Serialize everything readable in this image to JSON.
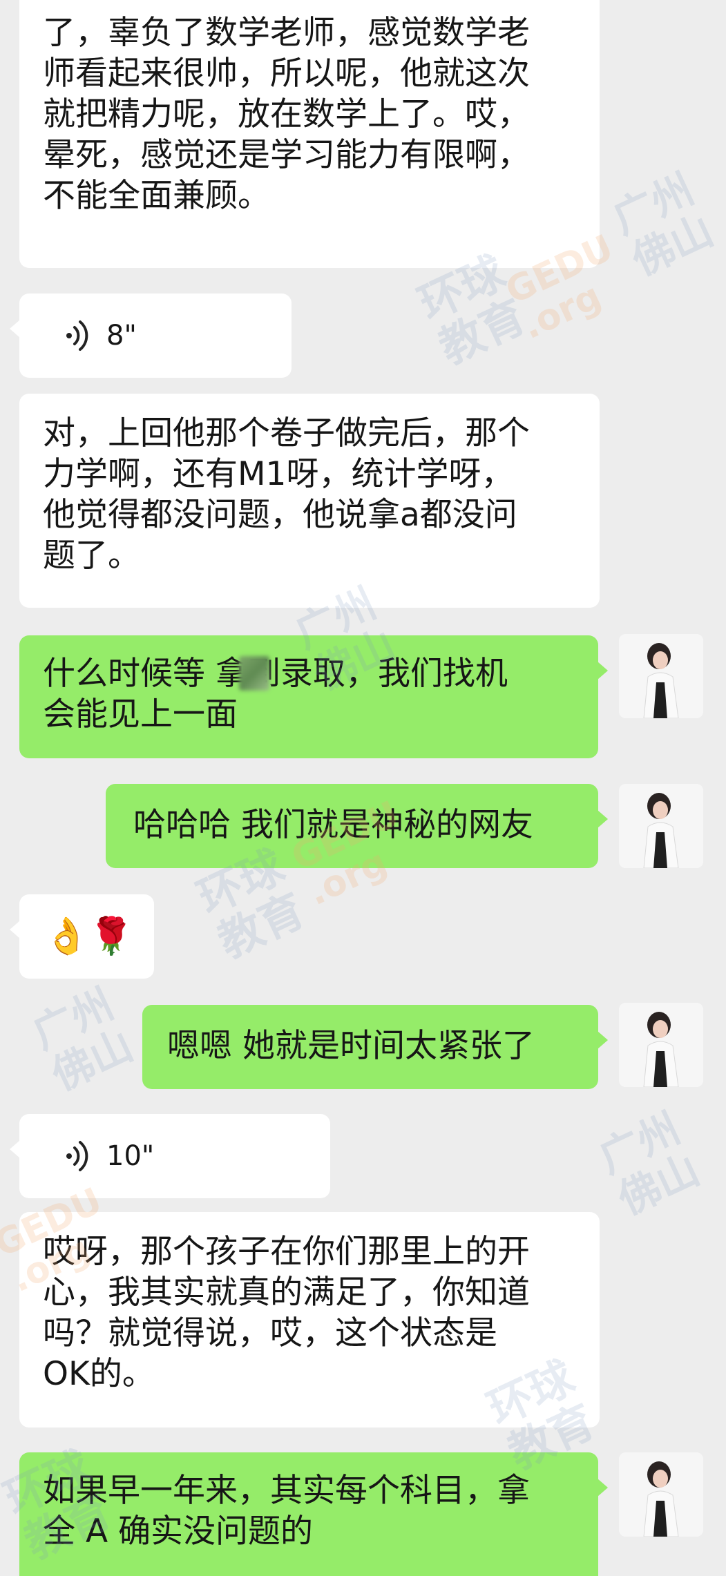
{
  "messages": [
    {
      "type": "text",
      "side": "left",
      "text": "了，辜负了数学老师，感觉数学老\n师看起来很帅，所以呢，他就这次\n就把精力呢，放在数学上了。哎，\n晕死，感觉还是学习能力有限啊，\n不能全面兼顾。"
    },
    {
      "type": "voice",
      "side": "left",
      "duration": "8\""
    },
    {
      "type": "text",
      "side": "left",
      "text": "对，上回他那个卷子做完后，那个\n力学啊，还有M1呀，统计学呀，\n他觉得都没问题，他说拿a都没问\n题了。"
    },
    {
      "type": "text",
      "side": "right",
      "text": "什么时候等   拿到录取，我们找机\n会能见上一面"
    },
    {
      "type": "text",
      "side": "right",
      "text": "哈哈哈 我们就是神秘的网友"
    },
    {
      "type": "emoji",
      "side": "left",
      "text": "👌🌹"
    },
    {
      "type": "text",
      "side": "right",
      "text": "嗯嗯 她就是时间太紧张了"
    },
    {
      "type": "voice",
      "side": "left",
      "duration": "10\""
    },
    {
      "type": "text",
      "side": "left",
      "text": "哎呀，那个孩子在你们那里上的开\n心，我其实就真的满足了，你知道\n吗？就觉得说，哎，这个状态是\nOK的。"
    },
    {
      "type": "text",
      "side": "right",
      "text": "如果早一年来，其实每个科目，拿\n全 A 确实没问题的"
    }
  ],
  "watermark": {
    "line1": "广州",
    "line2": "佛山",
    "brand": "环球",
    "brand2": "教育",
    "gedu": "GEDU",
    "org": ".org"
  },
  "colors": {
    "background": "#ededed",
    "incoming_bubble": "#ffffff",
    "outgoing_bubble": "#95ec69",
    "text": "#161616"
  }
}
